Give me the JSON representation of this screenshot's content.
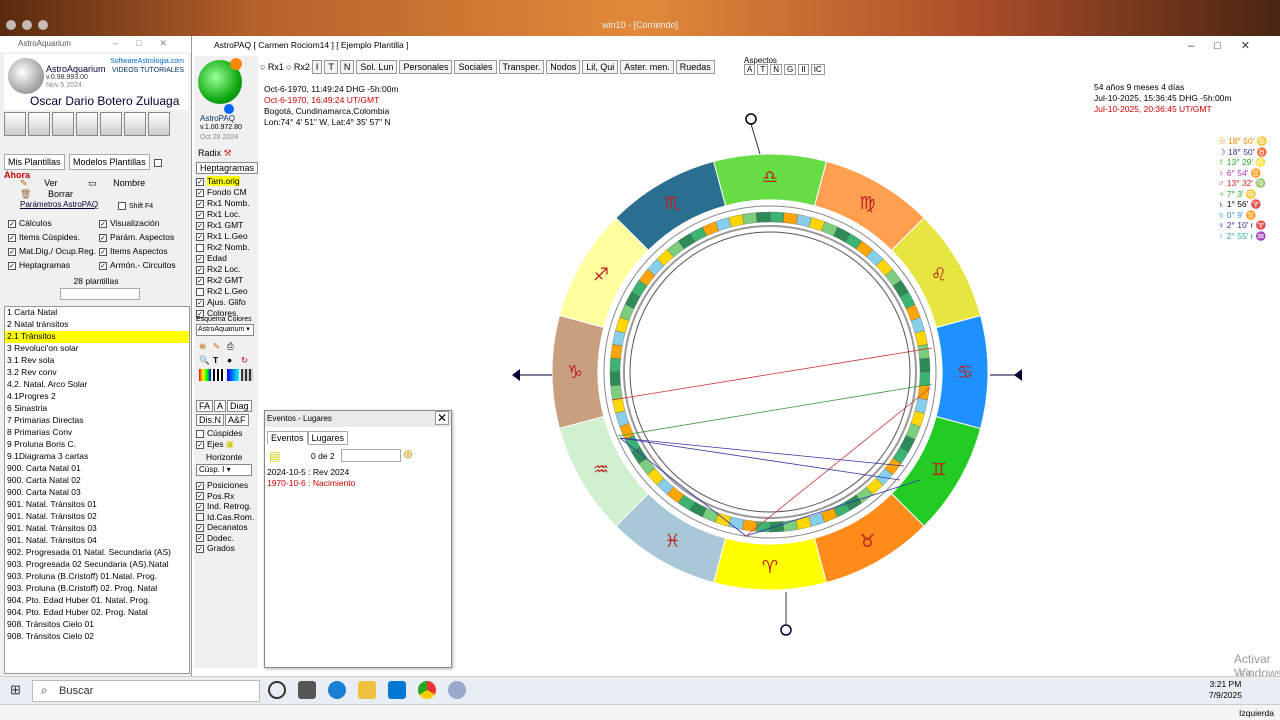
{
  "vm": {
    "title": "win10 - [Corriendo]"
  },
  "left_window": {
    "title": "AstroAquarium",
    "app_name": "AstroAquarium",
    "version": "v.0.98.993.00",
    "date": "Nov 5 2024",
    "site": "SoftwareAstrologia.com",
    "tutorials": "VIDEOS TUTORIALES",
    "author": "Oscar Dario Botero Zuluaga",
    "tabs": [
      "Mis Plantillas",
      "Modelos Plantillas"
    ],
    "ahora": "Ahora",
    "actions": {
      "ver": "Ver",
      "nombre": "Nombre",
      "borrar": "Borrar"
    },
    "params_link": "Parámetros AstroPAQ",
    "shift_label": "Shift F4",
    "checks": [
      [
        "Cálculos",
        "Visualización"
      ],
      [
        "Items Cúspides.",
        "Parám. Aspectos"
      ],
      [
        "Mat.Dig./ Ocup.Reg.",
        "Items Aspectos"
      ],
      [
        "Heptagramas",
        "Armón.- Circuitos"
      ]
    ],
    "count_label": "28 plantillas",
    "templates": [
      "1 Carta Natal",
      "2 Natal tránsitos",
      "2.1 Tránsitos",
      "3 Revoluci'on solar",
      "3.1 Rev sola",
      "3.2 Rev conv",
      "4,2.  Natal. Arco Solar",
      "4.1Progres 2",
      "6 Sinastria",
      "7 Primarias Directas",
      "8 Primarias Conv",
      "9 Proluna Boris C.",
      "9.1Diagrama 3 cartas",
      "900. Carta Natal 01",
      "900. Carta Natal 02",
      "900. Carta Natal 03",
      "901. Natal. Tránsitos 01",
      "901. Natal. Tránsitos 02",
      "901. Natal. Tránsitos 03",
      "901. Natal. Tránsitos 04",
      "902. Progresada 01 Natal. Secundaria (AS)",
      "903. Progresada 02 Secundaria (AS).Natal",
      "903. Proluna (B.Cristoff) 01.Natal. Prog.",
      "903. Proluna (B.Cristoff) 02. Prog. Natal",
      "904. Pto. Edad Huber 01. Natal. Prog.",
      "904. Pto. Edad Huber 02. Prog. Natal",
      "908. Tránsitos Cielo 01",
      "908. Tránsitos Cielo 02"
    ],
    "selected_index": 2
  },
  "main_window": {
    "title": "AstroPAQ   [ Carmen Rociom14 ]    [ Ejemplo Plantilla ]",
    "toolbar": [
      "Rx1",
      "Rx2",
      "I",
      "T",
      "N",
      "Sol. Lun",
      "Personales",
      "Sociales",
      "Transper.",
      "Nodos",
      "Lil, Qui",
      "Aster. men.",
      "Ruedas"
    ],
    "aspects_label": "Aspectos",
    "aspect_btns": [
      "A",
      "T",
      "N",
      "G",
      "II",
      "IC"
    ],
    "info_left": [
      {
        "text": "Oct-6-1970, 11:49:24 DHG -5h:00m",
        "color": "#000"
      },
      {
        "text": "Oct-6-1970, 16:49:24 UT/GMT",
        "color": "#c00"
      },
      {
        "text": "Bogotá, Cundinamarca,Colombia",
        "color": "#000"
      },
      {
        "text": "Lon:74° 4' 51\" W, Lat:4° 35' 57\" N",
        "color": "#000"
      }
    ],
    "info_right": [
      {
        "text": "54 años 9 meses 4 días",
        "color": "#000"
      },
      {
        "text": "Jul-10-2025, 15:36:45 DHG -5h:00m",
        "color": "#000"
      },
      {
        "text": "Jul-10-2025, 20:36:45 UT/GMT",
        "color": "#c00"
      }
    ],
    "legend": [
      {
        "text": "☉ 18° 50' ♋",
        "color": "#f80"
      },
      {
        "text": "☽ 18° 50' ♉",
        "color": "#33a"
      },
      {
        "text": "☿ 13° 29' ♌",
        "color": "#2a2"
      },
      {
        "text": "♀ 6° 54' ♊",
        "color": "#b3b"
      },
      {
        "text": "♂ 13° 32' ♍",
        "color": "#d22"
      },
      {
        "text": "♃ 7° 3' ♋",
        "color": "#2a2"
      },
      {
        "text": "♄ 1° 56' ♈",
        "color": "#000"
      },
      {
        "text": "♅ 0° 9' ♊",
        "color": "#49c"
      },
      {
        "text": "♆ 2° 10' r ♈",
        "color": "#33a"
      },
      {
        "text": "♇ 2° 55' r ♒",
        "color": "#3aa"
      }
    ],
    "watermark": "Activar Windows",
    "watermark_sub": "Ve a Configuración para activar Windows."
  },
  "tool_column": {
    "app_name": "AstroPAQ",
    "version": "v.1.00.972.80",
    "date": "Oct 28 2024",
    "radix": "Radix",
    "hept": "Heptagramas",
    "checks": [
      {
        "label": "Tam.orig",
        "checked": true,
        "hl": true
      },
      {
        "label": "Fondo  CM",
        "checked": true
      },
      {
        "label": "Rx1 Nomb.",
        "checked": true
      },
      {
        "label": "Rx1 Loc.",
        "checked": true
      },
      {
        "label": "Rx1 GMT",
        "checked": true
      },
      {
        "label": "Rx1 L.Geo",
        "checked": true
      },
      {
        "label": "Rx2 Nomb.",
        "checked": false
      },
      {
        "label": "Edad",
        "checked": true
      },
      {
        "label": "Rx2 Loc.",
        "checked": true
      },
      {
        "label": "Rx2 GMT",
        "checked": true
      },
      {
        "label": "Rx2 L.Geo",
        "checked": false
      },
      {
        "label": "Ajus. Glifo",
        "checked": true
      },
      {
        "label": "Colores",
        "checked": true
      }
    ],
    "scheme_label": "Esquema Colores",
    "scheme_value": "AstroAquarium",
    "btns1": [
      "FA",
      "A",
      "Diag"
    ],
    "btns2": [
      "Dis.N",
      "A&F"
    ],
    "cuspides": "Cúspides",
    "ejes": "Ejes",
    "horizonte": "Horizonte",
    "cusp_select": "Cúsp. I",
    "opts": [
      {
        "label": "Posiciones",
        "checked": true
      },
      {
        "label": "Pos.Rx",
        "checked": true
      },
      {
        "label": "Ind. Retrog.",
        "checked": true
      },
      {
        "label": "Id.Cas.Rom.",
        "checked": false
      },
      {
        "label": "Decanatos",
        "checked": true
      },
      {
        "label": "Dodec.",
        "checked": true
      },
      {
        "label": "Grados",
        "checked": true
      }
    ]
  },
  "events": {
    "title": "Eventos - Lugares",
    "tabs": [
      "Eventos",
      "Lugares"
    ],
    "count": "0 de 2",
    "items": [
      {
        "text": "2024-10-5 : Rev 2024",
        "color": "#000"
      },
      {
        "text": "1970-10-6 : Nacimiento",
        "color": "#c00"
      }
    ]
  },
  "taskbar": {
    "search": "Buscar",
    "time": "3:21 PM",
    "date": "7/9/2025",
    "lang": "Izquierda"
  },
  "zodiac": {
    "signs": [
      "♈",
      "♉",
      "♊",
      "♋",
      "♌",
      "♍",
      "♎",
      "♏",
      "♐",
      "♑",
      "♒",
      "♓"
    ],
    "colors": [
      "#ffff00",
      "#ff8c1a",
      "#22cc22",
      "#1e90ff",
      "#e6e640",
      "#ffa050",
      "#66dd44",
      "#2a6f8f",
      "#ffffa0",
      "#c8a080",
      "#d0f0d0",
      "#a8c8d8"
    ]
  }
}
